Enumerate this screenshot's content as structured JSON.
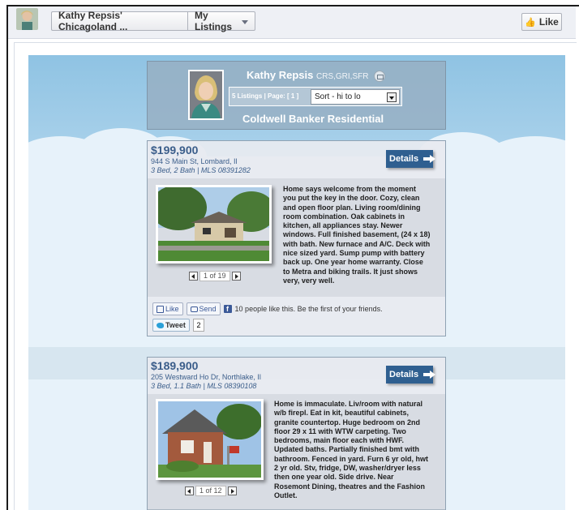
{
  "header": {
    "page_title": "Kathy Repsis' Chicagoland ...",
    "menu_label": "My Listings",
    "like_label": "Like"
  },
  "agent": {
    "name": "Kathy Repsis",
    "credentials": "CRS,GRI,SFR",
    "listings_info": "5 Listings | Page: [ 1 ]",
    "sort_value": "Sort - hi to lo",
    "brokerage": "Coldwell Banker Residential"
  },
  "listings": [
    {
      "price": "$199,900",
      "address": "944 S Main St, Lombard, Il",
      "beds": "3 Bed, 2 Bath | MLS 08391282",
      "details_label": "Details",
      "description_lines": [
        "Home says welcome from the moment",
        "you put the key in the door. Cozy, clean",
        "and open floor plan. Living room/dining",
        "room combination. Oak cabinets in",
        "kitchen, all appliances stay. Newer",
        "windows. Full finished basement, (24 x 18)",
        "with bath. New furnace and A/C. Deck with",
        "nice sized yard. Sump pump with battery",
        "back up. One year home warranty. Close",
        "to Metra and biking trails. It just shows",
        "very, very well."
      ],
      "pager": "1 of 19",
      "fb_like": "Like",
      "fb_send": "Send",
      "fb_text": "10 people like this. Be the first of your friends.",
      "tweet_label": "Tweet",
      "tweet_count": "2"
    },
    {
      "price": "$189,900",
      "address": "205 Westward Ho Dr, Northlake, Il",
      "beds": "3 Bed, 1.1 Bath | MLS 08390108",
      "details_label": "Details",
      "description_lines": [
        "Home is immaculate. Liv/room with natural",
        "w/b firepl. Eat in kit, beautiful cabinets,",
        "granite countertop. Huge bedroom on 2nd",
        "floor 29 x 11 with WTW carpeting. Two",
        "bedrooms, main floor each with HWF.",
        "Updated baths. Partially finished bmt with",
        "bathroom. Fenced in yard. Furn 6 yr old, hwt",
        "2 yr old. Stv, fridge, DW, washer/dryer less",
        "then one year old. Side drive. Near",
        "Rosemont Dining, theatres and the Fashion",
        "Outlet."
      ],
      "pager": "1 of 12"
    }
  ]
}
